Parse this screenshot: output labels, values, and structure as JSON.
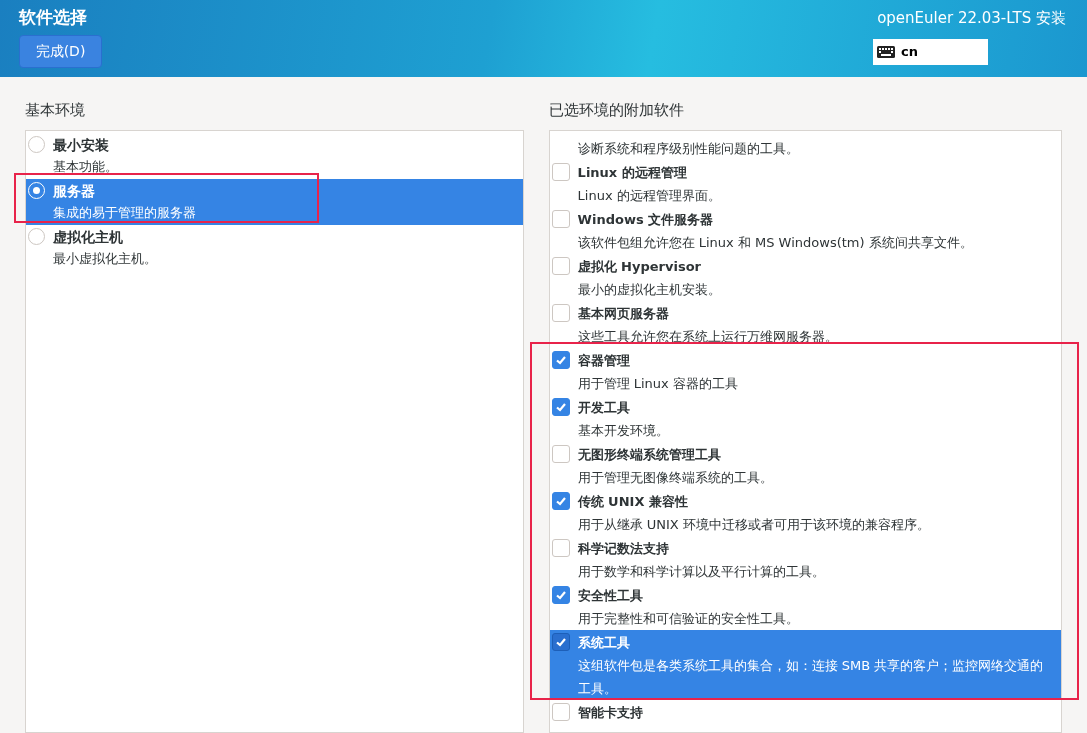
{
  "header": {
    "title": "软件选择",
    "done_button": "完成(D)",
    "product": "openEuler 22.03-LTS 安装",
    "keyboard_layout": "cn"
  },
  "environment": {
    "heading": "基本环境",
    "items": [
      {
        "title": "最小安装",
        "description": "基本功能。",
        "selected": false
      },
      {
        "title": "服务器",
        "description": "集成的易于管理的服务器",
        "selected": true
      },
      {
        "title": "虚拟化主机",
        "description": "最小虚拟化主机。",
        "selected": false
      }
    ]
  },
  "addons": {
    "heading": "已选环境的附加软件",
    "items": [
      {
        "kind": "partial",
        "description": "诊断系统和程序级别性能问题的工具。",
        "selected": false
      },
      {
        "kind": "full",
        "title": "Linux 的远程管理",
        "description": "Linux 的远程管理界面。",
        "checked": false,
        "selected": false
      },
      {
        "kind": "full",
        "title": "Windows 文件服务器",
        "description": "该软件包组允许您在 Linux 和 MS Windows(tm) 系统间共享文件。",
        "checked": false,
        "selected": false
      },
      {
        "kind": "full",
        "title": "虚拟化 Hypervisor",
        "description": "最小的虚拟化主机安装。",
        "checked": false,
        "selected": false
      },
      {
        "kind": "full",
        "title": "基本网页服务器",
        "description": "这些工具允许您在系统上运行万维网服务器。",
        "checked": false,
        "selected": false
      },
      {
        "kind": "full",
        "title": "容器管理",
        "description": "用于管理 Linux 容器的工具",
        "checked": true,
        "selected": false
      },
      {
        "kind": "full",
        "title": "开发工具",
        "description": "基本开发环境。",
        "checked": true,
        "selected": false
      },
      {
        "kind": "full",
        "title": "无图形终端系统管理工具",
        "description": "用于管理无图像终端系统的工具。",
        "checked": false,
        "selected": false
      },
      {
        "kind": "full",
        "title": "传统 UNIX 兼容性",
        "description": "用于从继承 UNIX 环境中迁移或者可用于该环境的兼容程序。",
        "checked": true,
        "selected": false
      },
      {
        "kind": "full",
        "title": "科学记数法支持",
        "description": "用于数学和科学计算以及平行计算的工具。",
        "checked": false,
        "selected": false
      },
      {
        "kind": "full",
        "title": "安全性工具",
        "description": "用于完整性和可信验证的安全性工具。",
        "checked": true,
        "selected": false
      },
      {
        "kind": "full",
        "title": "系统工具",
        "description": "这组软件包是各类系统工具的集合，如：连接 SMB 共享的客户；监控网络交通的工具。",
        "checked": true,
        "selected": true
      },
      {
        "kind": "title_only",
        "title": "智能卡支持",
        "checked": false,
        "selected": false
      }
    ]
  },
  "highlight_frames": [
    {
      "kind": "frame"
    },
    {
      "kind": "frame"
    }
  ]
}
